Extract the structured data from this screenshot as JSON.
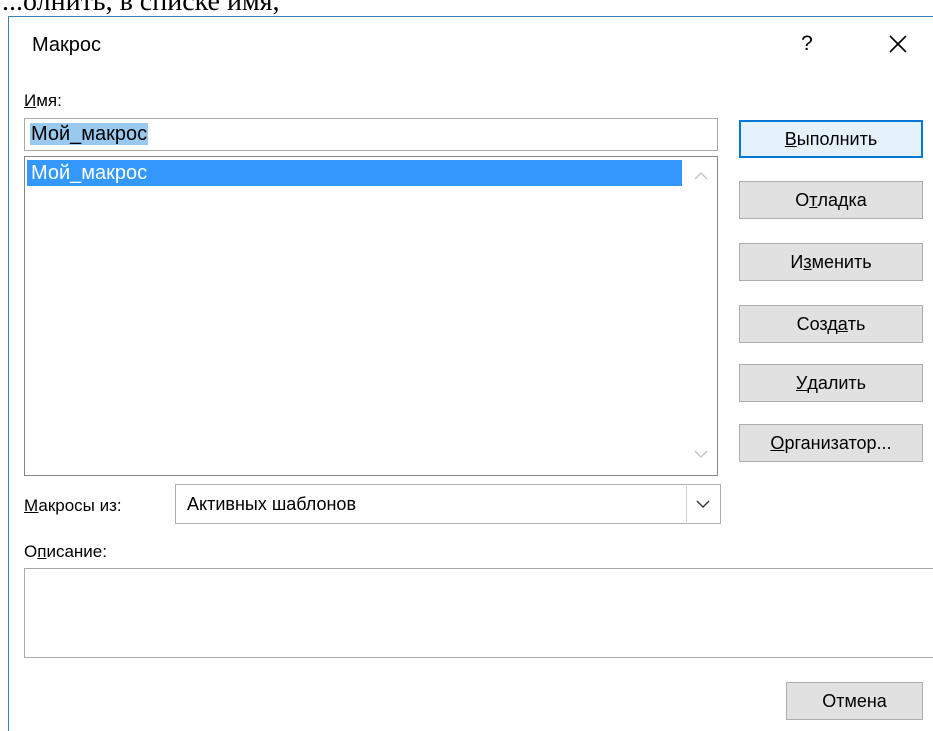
{
  "document": {
    "partial_text": "...олнить, в списке имя,"
  },
  "dialog": {
    "title": "Макрос",
    "help_label": "?",
    "close_icon": "close-icon",
    "name_label_first": "И",
    "name_label_rest": "мя:",
    "name_value": "Мой_макрос",
    "macro_list": [
      "Мой_макрос"
    ],
    "buttons": {
      "run": {
        "u": "В",
        "rest": "ыполнить"
      },
      "debug": {
        "pre": "О",
        "u": "т",
        "rest": "ладка"
      },
      "edit": {
        "pre": "И",
        "u": "з",
        "rest": "менить"
      },
      "create": {
        "pre": "Созд",
        "u": "а",
        "rest": "ть"
      },
      "delete": {
        "u": "У",
        "rest": "далить"
      },
      "organizer": {
        "u": "О",
        "rest": "рганизатор..."
      },
      "cancel": "Отмена"
    },
    "macros_in_label": {
      "u": "М",
      "rest": "акросы из:"
    },
    "macros_in_value": "Активных шаблонов",
    "description_label": {
      "pre": "О",
      "u": "п",
      "rest": "исание:"
    },
    "description_value": ""
  }
}
